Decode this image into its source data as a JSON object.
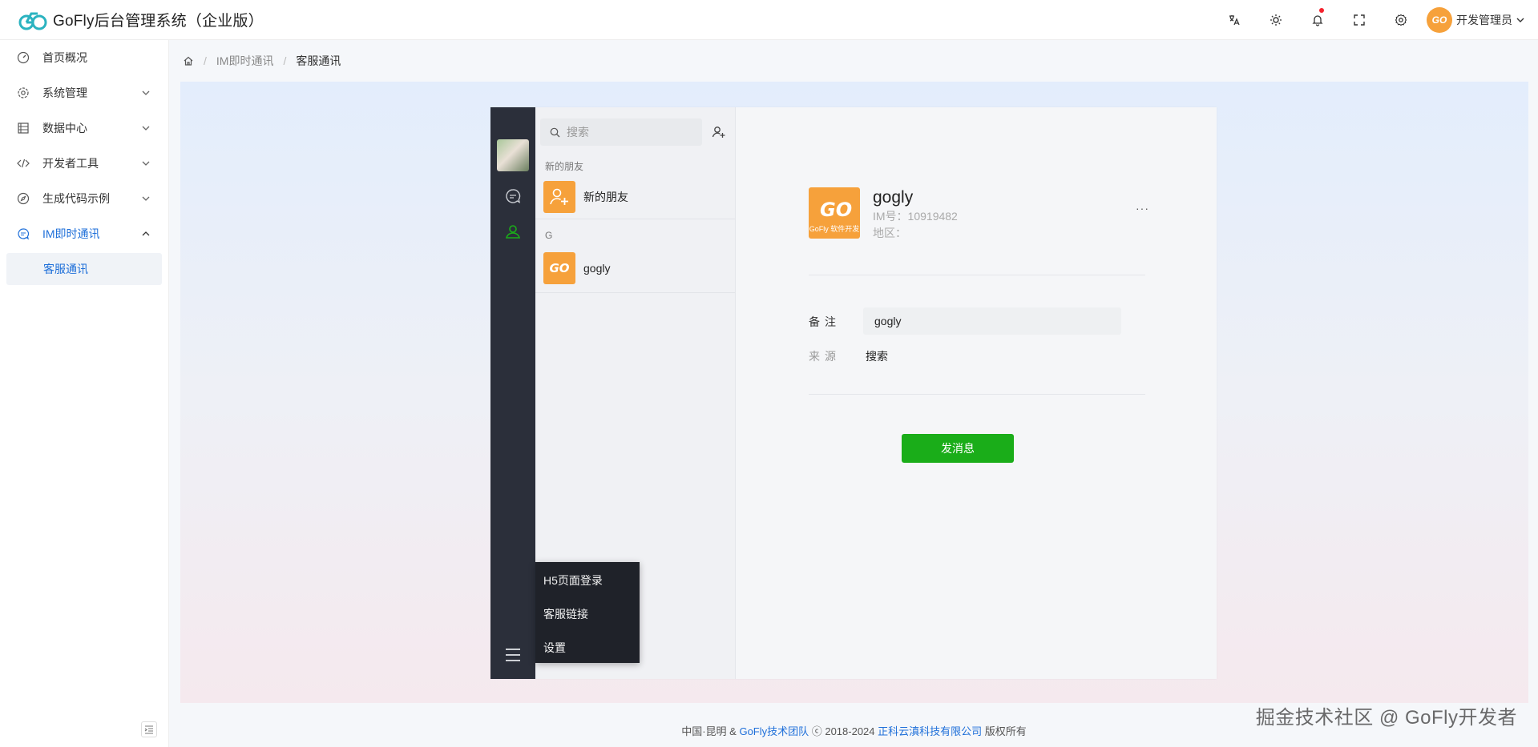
{
  "app": {
    "title": "GoFly后台管理系统（企业版）"
  },
  "header": {
    "user_name": "开发管理员",
    "avatar_text": "GO"
  },
  "sidebar": {
    "items": [
      {
        "label": "首页概况"
      },
      {
        "label": "系统管理"
      },
      {
        "label": "数据中心"
      },
      {
        "label": "开发者工具"
      },
      {
        "label": "生成代码示例"
      },
      {
        "label": "IM即时通讯"
      }
    ],
    "active_sub": "客服通讯"
  },
  "breadcrumb": {
    "level1": "IM即时通讯",
    "level2": "客服通讯"
  },
  "chat": {
    "search_placeholder": "搜索",
    "new_friends_header": "新的朋友",
    "new_friends_item": "新的朋友",
    "group_letter": "G",
    "contact_name": "gogly",
    "popup": [
      "H5页面登录",
      "客服链接",
      "设置"
    ],
    "profile": {
      "name": "gogly",
      "im_line": "IM号：10919482",
      "region_line": "地区：",
      "avatar_main": "GO",
      "avatar_sub": "GoFly 软件开发",
      "more": "···"
    },
    "remark_label": "备注",
    "remark_value": "gogly",
    "source_label": "来源",
    "source_value": "搜索",
    "send_label": "发消息"
  },
  "footer": {
    "prefix": "中国·昆明 & ",
    "team": "GoFly技术团队",
    "middle": " ⓒ 2018-2024 ",
    "company": "正科云滇科技有限公司",
    "suffix": " 版权所有"
  },
  "watermark": "掘金技术社区 @ GoFly开发者",
  "colors": {
    "accent": "#1e6fd9",
    "send": "#1aad19",
    "rail": "#2b2f3a",
    "avatar": "#f6a13b",
    "logo": "#2bb3c0"
  }
}
